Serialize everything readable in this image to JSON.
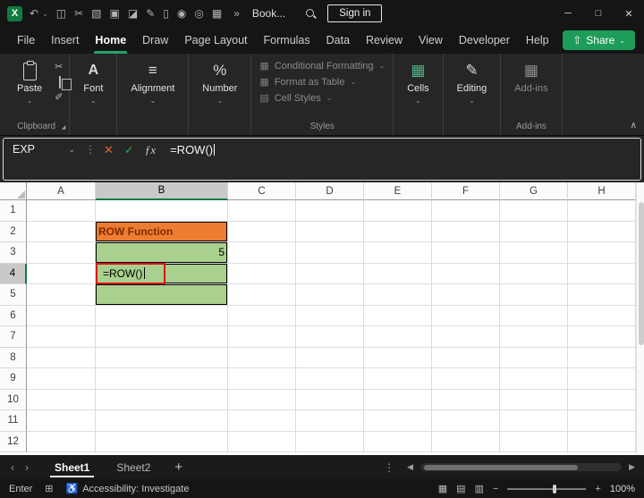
{
  "titlebar": {
    "workbook_name": "Book...",
    "sign_in_label": "Sign in",
    "app_logo_letter": "X",
    "qat_icons": [
      {
        "name": "copy-icon",
        "glyph": "◫"
      },
      {
        "name": "cut-icon",
        "glyph": "✂"
      },
      {
        "name": "picture-icon",
        "glyph": "▧"
      },
      {
        "name": "printer-icon",
        "glyph": "▣"
      },
      {
        "name": "highlighter-icon",
        "glyph": "◪"
      },
      {
        "name": "pen-icon",
        "glyph": "✎"
      },
      {
        "name": "document-icon",
        "glyph": "▯"
      },
      {
        "name": "pin-icon",
        "glyph": "◉"
      },
      {
        "name": "camera-icon",
        "glyph": "◎"
      },
      {
        "name": "table-icon",
        "glyph": "▦"
      }
    ]
  },
  "menubar": {
    "items": [
      "File",
      "Insert",
      "Home",
      "Draw",
      "Page Layout",
      "Formulas",
      "Data",
      "Review",
      "View",
      "Developer",
      "Help"
    ],
    "active": "Home",
    "share_label": "Share"
  },
  "ribbon": {
    "paste_label": "Paste",
    "clipboard_label": "Clipboard",
    "font_label": "Font",
    "alignment_label": "Alignment",
    "number_label": "Number",
    "styles_items": [
      {
        "label": "Conditional Formatting",
        "icon": "conditional-formatting-icon",
        "glyph": "▦"
      },
      {
        "label": "Format as Table",
        "icon": "format-as-table-icon",
        "glyph": "▦"
      },
      {
        "label": "Cell Styles",
        "icon": "cell-styles-icon",
        "glyph": "▤"
      }
    ],
    "styles_label": "Styles",
    "cells_label": "Cells",
    "editing_label": "Editing",
    "addins_label": "Add-ins",
    "addins_group_label": "Add-ins"
  },
  "formula_bar": {
    "name_box_value": "EXP",
    "formula": "=ROW()"
  },
  "grid": {
    "columns": [
      "A",
      "B",
      "C",
      "D",
      "E",
      "F",
      "G",
      "H"
    ],
    "row_count": 12,
    "selected_column": "B",
    "selected_row": 4,
    "cells": {
      "B2": {
        "text": "ROW Function",
        "fill": "orange",
        "align": "left"
      },
      "B3": {
        "text": "5",
        "fill": "green",
        "align": "right"
      },
      "B4": {
        "text": "=ROW()",
        "fill": "green",
        "align": "left",
        "annotated": true
      },
      "B5": {
        "text": "",
        "fill": "green",
        "align": "left"
      }
    }
  },
  "sheet_tabs": {
    "tabs": [
      "Sheet1",
      "Sheet2"
    ],
    "active": "Sheet1"
  },
  "status_bar": {
    "mode": "Enter",
    "accessibility_label": "Accessibility: Investigate",
    "zoom_level": "100%"
  },
  "icons": {
    "undo": "↶",
    "dropdown": "⌄",
    "overflow": "»",
    "minimize": "─",
    "maximize": "□",
    "close": "✕",
    "share": "⇧",
    "cut": "✂",
    "format_painter": "✐",
    "font": "A",
    "alignment": "≡",
    "number": "%",
    "cells": "▦",
    "editing": "✎",
    "addins": "▦",
    "launcher": "◢",
    "collapse_ribbon": "∧",
    "cancel": "✕",
    "enter": "✓",
    "fx": "ƒx",
    "menu_dots": "⋮",
    "tab_nav_left": "‹",
    "tab_nav_right": "›",
    "scroll_left": "◀",
    "scroll_right": "▶",
    "add_sheet": "+",
    "macro": "⊞",
    "accessibility": "♿",
    "view_normal": "▦",
    "view_layout": "▤",
    "view_break": "▥",
    "zoom_out": "−",
    "zoom_in": "+"
  },
  "colors": {
    "accent_green": "#21A366",
    "share_green": "#1E9C5A",
    "orange_fill": "#ED7D31",
    "orange_text": "#7F2B00",
    "green_fill": "#A9D08E",
    "annotation_red": "#E01010",
    "selected_header_gray": "#C9C9C9"
  }
}
